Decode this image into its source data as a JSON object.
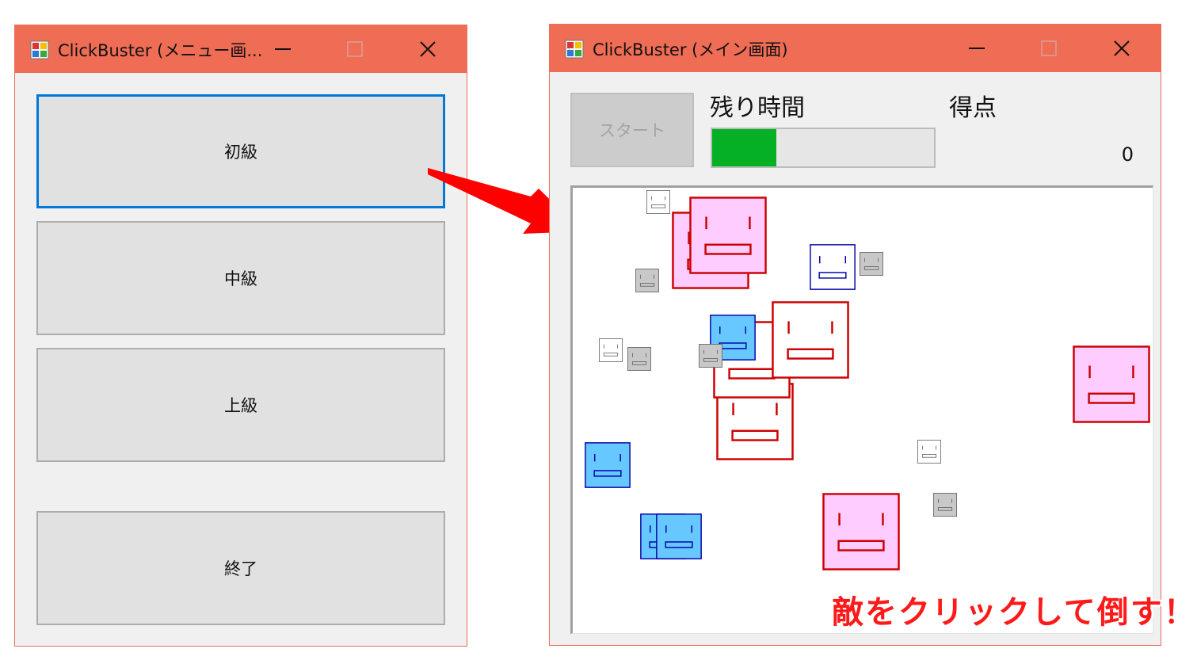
{
  "menu_window": {
    "title": "ClickBuster (メニュー画...",
    "buttons": [
      {
        "label": "初級",
        "focused": true
      },
      {
        "label": "中級",
        "focused": false
      },
      {
        "label": "上級",
        "focused": false
      },
      {
        "label": "終了",
        "focused": false
      }
    ]
  },
  "main_window": {
    "title": "ClickBuster (メイン画面)",
    "start_label": "スタート",
    "start_enabled": false,
    "time_label": "残り時間",
    "time_remaining_fraction": 0.29,
    "score_label": "得点",
    "score_value": "0"
  },
  "caption": "敵をクリックして倒す！",
  "colors": {
    "titlebar": "#ef6c55",
    "focus_border": "#0078d7",
    "progress": "#06b025",
    "arrow": "#ff0000",
    "enemy_pink_fill": "#ffccff",
    "enemy_pink_stroke": "#cc0000",
    "enemy_blue_fill": "#66c8ff",
    "enemy_blue_stroke": "#0000aa",
    "enemy_gray_fill": "#c8c8c8",
    "enemy_gray_stroke": "#555555"
  },
  "enemy_types": [
    "pink-large",
    "white-large",
    "blue-medium",
    "white-medium-blue",
    "gray-small",
    "white-small"
  ]
}
